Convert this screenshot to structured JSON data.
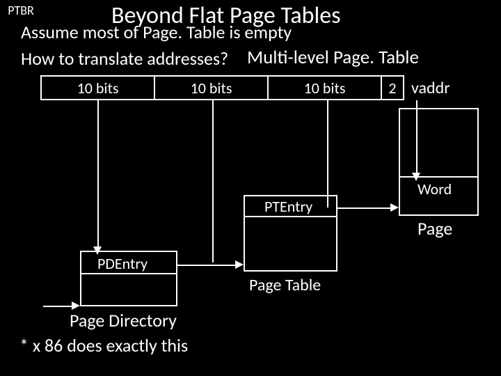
{
  "title": "Beyond Flat Page Tables",
  "line1": "Assume most of Page. Table is empty",
  "line2": "How to translate addresses?",
  "line2b": "Multi-level Page. Table",
  "vaddr": {
    "b1": "10 bits",
    "b2": "10 bits",
    "b3": "10 bits",
    "b4": "2",
    "label": "vaddr"
  },
  "labels": {
    "word": "Word",
    "page": "Page",
    "ptentry": "PTEntry",
    "pagetable": "Page Table",
    "pdentry": "PDEntry",
    "pagedir": "Page Directory",
    "ptbr": "PTBR"
  },
  "footnote": "* x 86 does exactly this"
}
